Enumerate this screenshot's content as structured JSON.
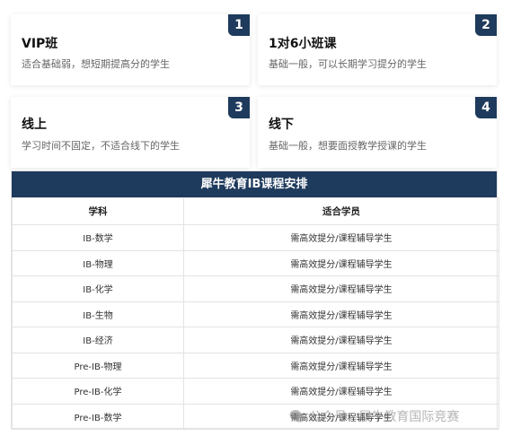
{
  "cards": [
    {
      "num": "1",
      "title": "VIP班",
      "desc": "适合基础弱，想短期提高分的学生"
    },
    {
      "num": "2",
      "title": "1对6小班课",
      "desc": "基础一般，可以长期学习提分的学生"
    },
    {
      "num": "3",
      "title": "线上",
      "desc": "学习时间不固定，不适合线下的学生"
    },
    {
      "num": "4",
      "title": "线下",
      "desc": "基础一般，想要面授教学授课的学生"
    }
  ],
  "table": {
    "title": "犀牛教育IB课程安排",
    "headers": {
      "subject": "学科",
      "students": "适合学员"
    },
    "rows": [
      {
        "subject": "IB-数学",
        "students": "需高效提分/课程辅导学生"
      },
      {
        "subject": "IB-物理",
        "students": "需高效提分/课程辅导学生"
      },
      {
        "subject": "IB-化学",
        "students": "需高效提分/课程辅导学生"
      },
      {
        "subject": "IB-生物",
        "students": "需高效提分/课程辅导学生"
      },
      {
        "subject": "IB-经济",
        "students": "需高效提分/课程辅导学生"
      },
      {
        "subject": "Pre-IB-物理",
        "students": "需高效提分/课程辅导学生"
      },
      {
        "subject": "Pre-IB-化学",
        "students": "需高效提分/课程辅导学生"
      },
      {
        "subject": "Pre-IB-数学",
        "students": "需高效提分/课程辅导学生"
      }
    ]
  },
  "watermark": {
    "text": "公众号 · 犀牛教育国际竞赛",
    "icon": "wechat-icon"
  },
  "colors": {
    "accent": "#1e3a5c"
  }
}
